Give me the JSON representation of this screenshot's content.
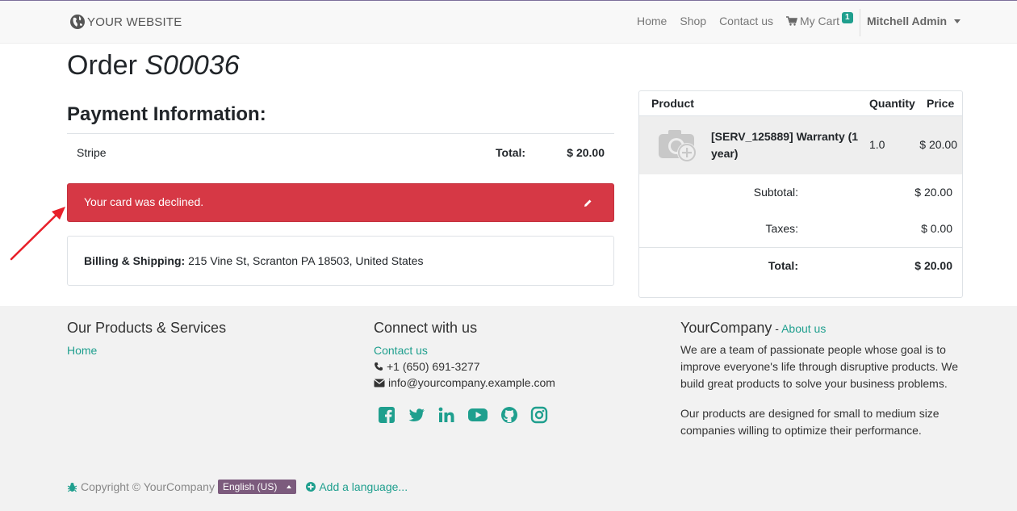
{
  "nav": {
    "brand": "YOUR WEBSITE",
    "links": [
      "Home",
      "Shop",
      "Contact us"
    ],
    "cart_label": "My Cart",
    "cart_count": "1",
    "user": "Mitchell Admin"
  },
  "order": {
    "title_prefix": "Order",
    "number": "S00036"
  },
  "payment": {
    "heading": "Payment Information:",
    "method": "Stripe",
    "total_label": "Total:",
    "total_value": "$ 20.00",
    "error_message": "Your card was declined."
  },
  "address": {
    "label": "Billing & Shipping:",
    "value": "215 Vine St, Scranton PA 18503, United States"
  },
  "summary": {
    "headers": {
      "product": "Product",
      "quantity": "Quantity",
      "price": "Price"
    },
    "line": {
      "name": "[SERV_125889] Warranty (1 year)",
      "quantity": "1.0",
      "price": "$ 20.00"
    },
    "subtotal_label": "Subtotal:",
    "subtotal_value": "$ 20.00",
    "taxes_label": "Taxes:",
    "taxes_value": "$ 0.00",
    "total_label": "Total:",
    "total_value": "$ 20.00"
  },
  "footer": {
    "col1": {
      "heading": "Our Products & Services",
      "link": "Home"
    },
    "col2": {
      "heading": "Connect with us",
      "link": "Contact us",
      "phone": "+1 (650) 691-3277",
      "email": "info@yourcompany.example.com",
      "socials": [
        "facebook-icon",
        "twitter-icon",
        "linkedin-icon",
        "youtube-icon",
        "github-icon",
        "instagram-icon"
      ]
    },
    "col3": {
      "company": "YourCompany",
      "separator": " - ",
      "about_link": "About us",
      "para1": "We are a team of passionate people whose goal is to improve everyone's life through disruptive products. We build great products to solve your business problems.",
      "para2": "Our products are designed for small to medium size companies willing to optimize their performance."
    },
    "copyright": "Copyright © YourCompany",
    "language": "English (US)",
    "add_language": "Add a language..."
  },
  "colors": {
    "accent": "#1f9f8e",
    "danger": "#d63845",
    "lang_badge": "#7c5b7d",
    "annotation_arrow": "#e8202a"
  }
}
